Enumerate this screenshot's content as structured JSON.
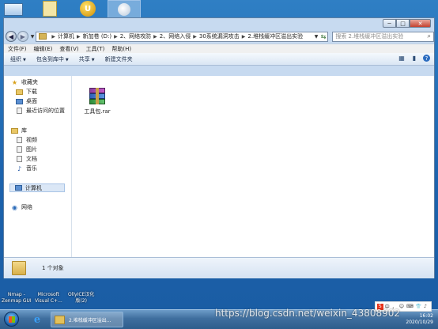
{
  "window": {
    "buttons": {
      "minimize": "─",
      "maximize": "□",
      "close": "✕"
    }
  },
  "address": {
    "crumbs": [
      "计算机",
      "新加卷 (D:)",
      "2、网络攻防",
      "2、网络入侵",
      "30系统漏洞攻击",
      "2.堆栈缓冲区溢出实验"
    ],
    "search_placeholder": "搜索 2.堆栈缓冲区溢出实验"
  },
  "menubar": {
    "items": [
      "文件(F)",
      "编辑(E)",
      "查看(V)",
      "工具(T)",
      "帮助(H)"
    ]
  },
  "toolbar": {
    "organize": "组织",
    "include_in_library": "包含到库中",
    "share": "共享",
    "new_folder": "新建文件夹"
  },
  "navpane": {
    "favorites": "收藏夹",
    "downloads": "下载",
    "desktop": "桌面",
    "recent": "最近访问的位置",
    "libraries": "库",
    "videos": "视频",
    "pictures": "图片",
    "documents": "文档",
    "music": "音乐",
    "computer": "计算机",
    "network": "网络"
  },
  "files": [
    {
      "name": "工具包.rar",
      "icon": "winrar-archive-icon"
    }
  ],
  "details": {
    "count": "1 个对象"
  },
  "desktop_labels": [
    {
      "text": "Nmap -\nZenmap GUI"
    },
    {
      "text": "Microsoft\nVisual C+..."
    },
    {
      "text": "OllyICE汉化\n版(2)"
    }
  ],
  "taskbar": {
    "explorer_label": "2.堆栈缓冲区溢出..."
  },
  "tray": {
    "ime": [
      "中",
      "，",
      "☺",
      "⌨",
      "👕",
      "♪"
    ],
    "time": "16:02",
    "date": "2020/10/29"
  },
  "watermark": "https://blog.csdn.net/weixin_43808902"
}
